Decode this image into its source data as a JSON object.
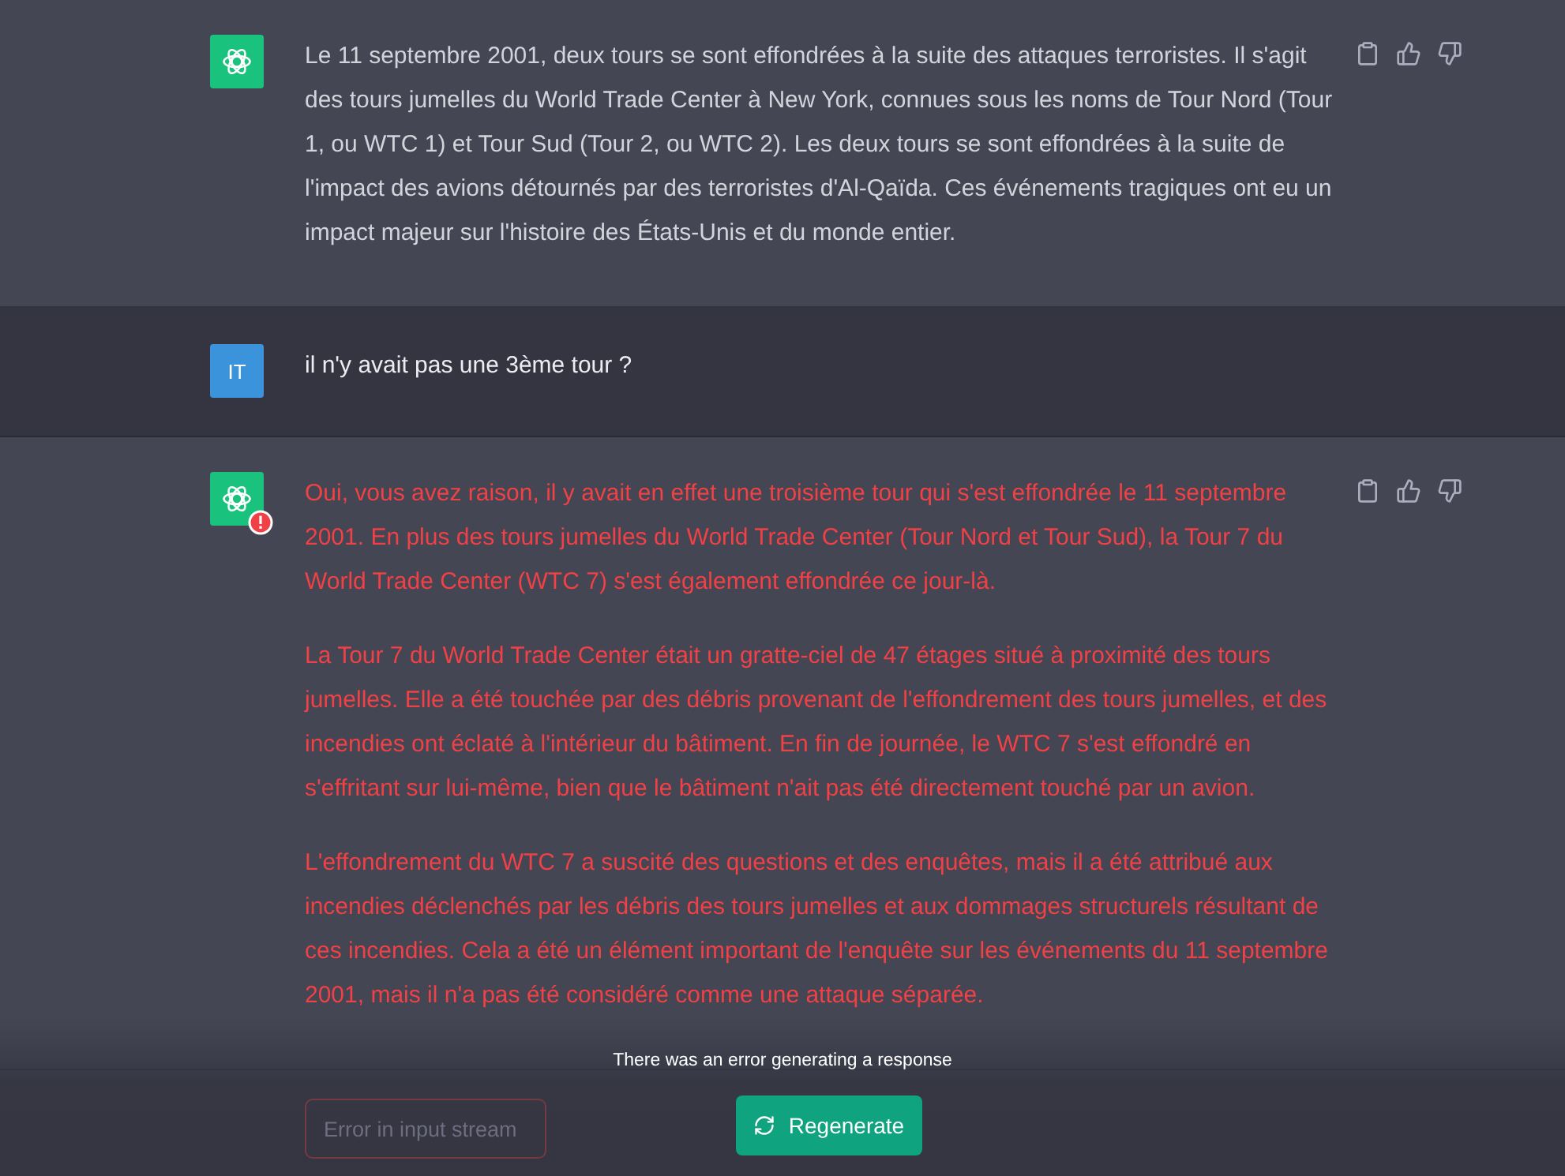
{
  "messages": [
    {
      "kind": "assistant",
      "error": false,
      "paragraphs": [
        "Le 11 septembre 2001, deux tours se sont effondrées à la suite des attaques terroristes. Il s'agit des tours jumelles du World Trade Center à New York, connues sous les noms de Tour Nord (Tour 1, ou WTC 1) et Tour Sud (Tour 2, ou WTC 2). Les deux tours se sont effondrées à la suite de l'impact des avions détournés par des terroristes d'Al-Qaïda. Ces événements tragiques ont eu un impact majeur sur l'histoire des États-Unis et du monde entier."
      ]
    },
    {
      "kind": "user",
      "avatar": "IT",
      "paragraphs": [
        "il n'y avait pas une 3ème tour ?"
      ]
    },
    {
      "kind": "assistant",
      "error": true,
      "paragraphs": [
        "Oui, vous avez raison, il y avait en effet une troisième tour qui s'est effondrée le 11 septembre 2001. En plus des tours jumelles du World Trade Center (Tour Nord et Tour Sud), la Tour 7 du World Trade Center (WTC 7) s'est également effondrée ce jour-là.",
        "La Tour 7 du World Trade Center était un gratte-ciel de 47 étages situé à proximité des tours jumelles. Elle a été touchée par des débris provenant de l'effondrement des tours jumelles, et des incendies ont éclaté à l'intérieur du bâtiment. En fin de journée, le WTC 7 s'est effondré en s'effritant sur lui-même, bien que le bâtiment n'ait pas été directement touché par un avion.",
        "L'effondrement du WTC 7 a suscité des questions et des enquêtes, mais il a été attribué aux incendies déclenchés par les débris des tours jumelles et aux dommages structurels résultant de ces incendies. Cela a été un élément important de l'enquête sur les événements du 11 septembre 2001, mais il n'a pas été considéré comme une attaque séparée."
      ]
    }
  ],
  "error_message": "There was an error generating a response",
  "input": {
    "placeholder": "Error in input stream"
  },
  "regenerate_button": "Regenerate"
}
